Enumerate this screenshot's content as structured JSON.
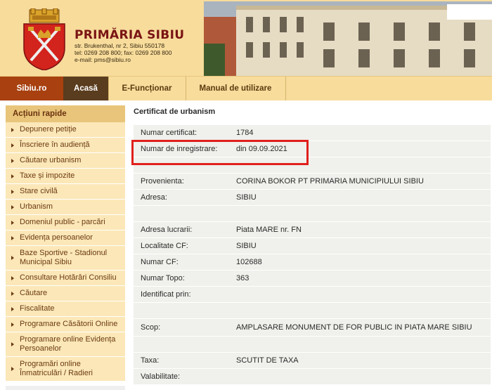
{
  "header": {
    "title": "PRIMĂRIA SIBIU",
    "address": "str. Brukenthal, nr 2, Sibiu 550178",
    "phone": "tel: 0269 208 800; fax: 0269 208 800",
    "email": "e-mail: pms@sibiu.ro"
  },
  "nav": {
    "items": [
      {
        "label": "Sibiu.ro"
      },
      {
        "label": "Acasă"
      },
      {
        "label": "E-Funcționar"
      },
      {
        "label": "Manual de utilizare"
      }
    ]
  },
  "sidebar": {
    "title": "Acțiuni rapide",
    "items": [
      {
        "label": "Depunere petiție"
      },
      {
        "label": "Înscriere în audiență"
      },
      {
        "label": "Căutare urbanism"
      },
      {
        "label": "Taxe și impozite"
      },
      {
        "label": "Stare civilă"
      },
      {
        "label": "Urbanism"
      },
      {
        "label": "Domeniul public - parcări"
      },
      {
        "label": "Evidența persoanelor"
      },
      {
        "label": "Baze Sportive - Stadionul Municipal Sibiu"
      },
      {
        "label": "Consultare Hotărâri Consiliu"
      },
      {
        "label": "Căutare"
      },
      {
        "label": "Fiscalitate"
      },
      {
        "label": "Programare Căsătorii Online"
      },
      {
        "label": "Programare online Evidența Persoanelor"
      },
      {
        "label": "Programări online Înmatriculări / Radieri"
      }
    ]
  },
  "content": {
    "title": "Certificat de urbanism",
    "rows": [
      {
        "label": "Numar certificat:",
        "value": "1784"
      },
      {
        "label": "Numar de inregistrare:",
        "value": "din 09.09.2021"
      },
      {
        "label": "",
        "value": ""
      },
      {
        "label": "Provenienta:",
        "value": "CORINA BOKOR PT PRIMARIA MUNICIPIULUI SIBIU"
      },
      {
        "label": "Adresa:",
        "value": "SIBIU"
      },
      {
        "label": "",
        "value": ""
      },
      {
        "label": "Adresa lucrarii:",
        "value": "Piata MARE nr. FN"
      },
      {
        "label": "Localitate CF:",
        "value": "SIBIU"
      },
      {
        "label": "Numar CF:",
        "value": "102688"
      },
      {
        "label": "Numar Topo:",
        "value": "363"
      },
      {
        "label": "Identificat prin:",
        "value": ""
      },
      {
        "label": "",
        "value": ""
      },
      {
        "label": "Scop:",
        "value": "AMPLASARE MONUMENT DE FOR PUBLIC IN PIATA MARE SIBIU"
      },
      {
        "label": "",
        "value": ""
      },
      {
        "label": "Taxa:",
        "value": "SCUTIT DE TAXA"
      },
      {
        "label": "Valabilitate:",
        "value": ""
      }
    ]
  },
  "colors": {
    "header_bg": "#f7dc9c",
    "brand_red": "#7a1414",
    "nav_active": "#a84010",
    "nav_dark": "#5a3c1e",
    "sidebar_item_bg": "#fbe7b8",
    "highlight_border": "#e0201c"
  },
  "icons": {
    "crest": "sibiu-coat-of-arms-icon",
    "bullet": "triangle-bullet-icon"
  }
}
